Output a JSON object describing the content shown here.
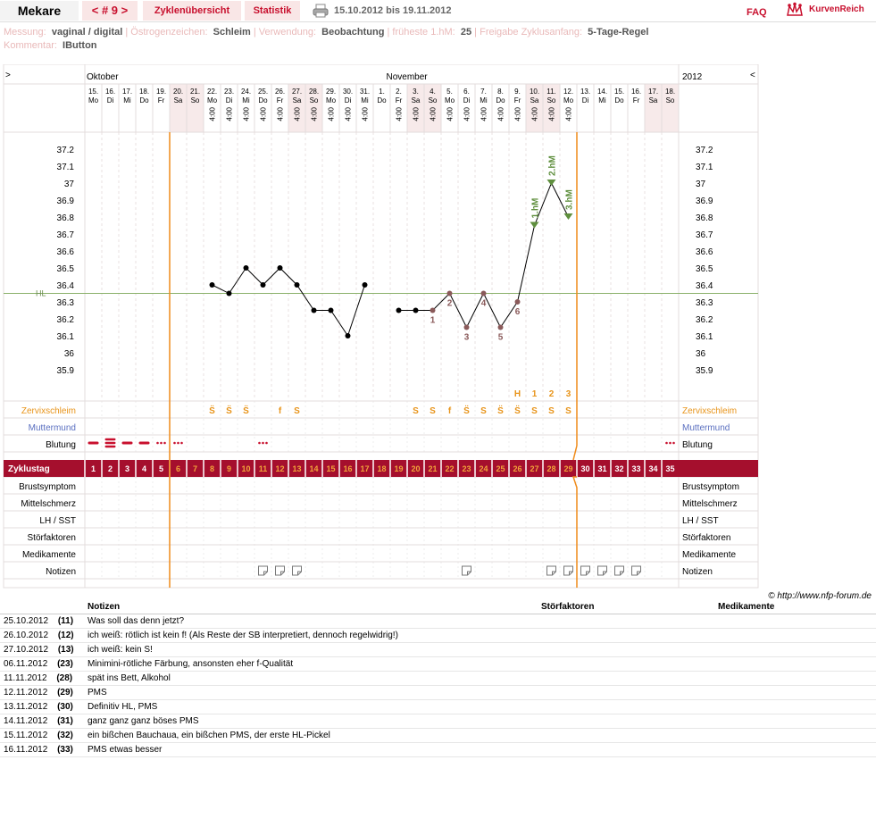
{
  "header": {
    "user": "Mekare",
    "cycle_nav": "< # 9 >",
    "tab_overview": "Zyklenübersicht",
    "tab_stats": "Statistik",
    "date_range": "15.10.2012 bis 19.11.2012",
    "faq": "FAQ",
    "logo": "KurvenReich"
  },
  "info": {
    "messung_label": "Messung:",
    "messung": "vaginal / digital",
    "oestrogen_label": "Östrogenzeichen:",
    "oestrogen": "Schleim",
    "verwendung_label": "Verwendung:",
    "verwendung": "Beobachtung",
    "fhm_label": "früheste 1.hM:",
    "fhm": "25",
    "freigabe_label": "Freigabe Zyklusanfang:",
    "freigabe": "5-Tage-Regel",
    "kommentar_label": "Kommentar:",
    "kommentar": "IButton"
  },
  "chart": {
    "month_left": "Oktober",
    "month_mid": "November",
    "year": "2012",
    "nav_prev": ">",
    "nav_next": "<",
    "hl_label": "HL",
    "hl_value": 36.35,
    "y_ticks": [
      "37.2",
      "37.1",
      "37",
      "36.9",
      "36.8",
      "36.7",
      "36.6",
      "36.5",
      "36.4",
      "36.3",
      "36.2",
      "36.1",
      "36",
      "35.9"
    ],
    "days": [
      {
        "d": "15.",
        "w": "Mo",
        "t": "",
        "c": "1"
      },
      {
        "d": "16.",
        "w": "Di",
        "t": "",
        "c": "2"
      },
      {
        "d": "17.",
        "w": "Mi",
        "t": "",
        "c": "3"
      },
      {
        "d": "18.",
        "w": "Do",
        "t": "",
        "c": "4"
      },
      {
        "d": "19.",
        "w": "Fr",
        "t": "",
        "c": "5"
      },
      {
        "d": "20.",
        "w": "Sa",
        "t": "",
        "c": "6"
      },
      {
        "d": "21.",
        "w": "So",
        "t": "",
        "c": "7"
      },
      {
        "d": "22.",
        "w": "Mo",
        "t": "4:00",
        "c": "8"
      },
      {
        "d": "23.",
        "w": "Di",
        "t": "4:00",
        "c": "9"
      },
      {
        "d": "24.",
        "w": "Mi",
        "t": "4:00",
        "c": "10"
      },
      {
        "d": "25.",
        "w": "Do",
        "t": "4:00",
        "c": "11"
      },
      {
        "d": "26.",
        "w": "Fr",
        "t": "4:00",
        "c": "12"
      },
      {
        "d": "27.",
        "w": "Sa",
        "t": "4:00",
        "c": "13"
      },
      {
        "d": "28.",
        "w": "So",
        "t": "4:00",
        "c": "14"
      },
      {
        "d": "29.",
        "w": "Mo",
        "t": "4:00",
        "c": "15"
      },
      {
        "d": "30.",
        "w": "Di",
        "t": "4:00",
        "c": "16"
      },
      {
        "d": "31.",
        "w": "Mi",
        "t": "4:00",
        "c": "17"
      },
      {
        "d": "1.",
        "w": "Do",
        "t": "",
        "c": "18"
      },
      {
        "d": "2.",
        "w": "Fr",
        "t": "4:00",
        "c": "19"
      },
      {
        "d": "3.",
        "w": "Sa",
        "t": "4:00",
        "c": "20"
      },
      {
        "d": "4.",
        "w": "So",
        "t": "4:00",
        "c": "21"
      },
      {
        "d": "5.",
        "w": "Mo",
        "t": "4:00",
        "c": "22"
      },
      {
        "d": "6.",
        "w": "Di",
        "t": "4:00",
        "c": "23"
      },
      {
        "d": "7.",
        "w": "Mi",
        "t": "4:00",
        "c": "24"
      },
      {
        "d": "8.",
        "w": "Do",
        "t": "4:00",
        "c": "25"
      },
      {
        "d": "9.",
        "w": "Fr",
        "t": "4:00",
        "c": "26"
      },
      {
        "d": "10.",
        "w": "Sa",
        "t": "4:00",
        "c": "27"
      },
      {
        "d": "11.",
        "w": "So",
        "t": "4:00",
        "c": "28"
      },
      {
        "d": "12.",
        "w": "Mo",
        "t": "4:00",
        "c": "29"
      },
      {
        "d": "13.",
        "w": "Di",
        "t": "",
        "c": "30"
      },
      {
        "d": "14.",
        "w": "Mi",
        "t": "",
        "c": "31"
      },
      {
        "d": "15.",
        "w": "Do",
        "t": "",
        "c": "32"
      },
      {
        "d": "16.",
        "w": "Fr",
        "t": "",
        "c": "33"
      },
      {
        "d": "17.",
        "w": "Sa",
        "t": "",
        "c": "34"
      },
      {
        "d": "18.",
        "w": "So",
        "t": "",
        "c": "35"
      }
    ],
    "rows_left": [
      "Zervixschleim",
      "Muttermund",
      "Blutung",
      "Zyklustag",
      "Brustsymptom",
      "Mittelschmerz",
      "LH / SST",
      "Störfaktoren",
      "Medikamente",
      "Notizen"
    ],
    "rows_right": [
      "Zervixschleim",
      "Muttermund",
      "Blutung",
      "Brustsymptom",
      "Mittelschmerz",
      "LH / SST",
      "Störfaktoren",
      "Medikamente",
      "Notizen"
    ],
    "copyright": "© http://www.nfp-forum.de"
  },
  "chart_data": {
    "type": "line",
    "xlabel": "",
    "ylabel": "",
    "ylim": [
      35.9,
      37.2
    ],
    "series": [
      {
        "points": [
          [
            8,
            36.4
          ],
          [
            9,
            36.35
          ],
          [
            10,
            36.5
          ],
          [
            11,
            36.4
          ],
          [
            12,
            36.5
          ],
          [
            13,
            36.4
          ],
          [
            14,
            36.25
          ],
          [
            15,
            36.25
          ],
          [
            16,
            36.1
          ],
          [
            17,
            36.4
          ]
        ]
      },
      {
        "points": [
          [
            19,
            36.25
          ],
          [
            20,
            36.25
          ],
          [
            21,
            36.25
          ],
          [
            22,
            36.35
          ],
          [
            23,
            36.15
          ],
          [
            24,
            36.35
          ],
          [
            25,
            36.15
          ],
          [
            26,
            36.3
          ],
          [
            27,
            36.75
          ],
          [
            28,
            37.0
          ],
          [
            29,
            36.8
          ]
        ]
      }
    ],
    "low_marks": [
      {
        "day": 21,
        "n": "1"
      },
      {
        "day": 22,
        "n": "2"
      },
      {
        "day": 23,
        "n": "3"
      },
      {
        "day": 24,
        "n": "4"
      },
      {
        "day": 25,
        "n": "5"
      },
      {
        "day": 26,
        "n": "6"
      }
    ],
    "high_marks": [
      {
        "day": 27,
        "n": "1.hM"
      },
      {
        "day": 28,
        "n": "2.hM"
      },
      {
        "day": 29,
        "n": "3.hM"
      }
    ],
    "mucus": [
      {
        "day": 8,
        "s": "S̈"
      },
      {
        "day": 9,
        "s": "S̈"
      },
      {
        "day": 10,
        "s": "S̈"
      },
      {
        "day": 12,
        "s": "f"
      },
      {
        "day": 13,
        "s": "S"
      },
      {
        "day": 20,
        "s": "S"
      },
      {
        "day": 21,
        "s": "S"
      },
      {
        "day": 22,
        "s": "f"
      },
      {
        "day": 23,
        "s": "S̈"
      },
      {
        "day": 24,
        "s": "S"
      },
      {
        "day": 25,
        "s": "S̈"
      },
      {
        "day": 26,
        "s": "S̈"
      },
      {
        "day": 27,
        "s": "S"
      },
      {
        "day": 28,
        "s": "S"
      },
      {
        "day": 29,
        "s": "S"
      }
    ],
    "mucus_eval": [
      {
        "day": 26,
        "s": "H"
      },
      {
        "day": 27,
        "s": "1"
      },
      {
        "day": 28,
        "s": "2"
      },
      {
        "day": 29,
        "s": "3"
      }
    ],
    "bleeding": [
      {
        "day": 1,
        "k": "dash"
      },
      {
        "day": 2,
        "k": "bars"
      },
      {
        "day": 3,
        "k": "dash"
      },
      {
        "day": 4,
        "k": "dash"
      },
      {
        "day": 5,
        "k": "dots"
      },
      {
        "day": 6,
        "k": "dots"
      },
      {
        "day": 11,
        "k": "dots"
      },
      {
        "day": 35,
        "k": "dots"
      }
    ],
    "notes_days": [
      11,
      12,
      13,
      23,
      28,
      29,
      30,
      31,
      32,
      33
    ]
  },
  "notes": {
    "col_notes": "Notizen",
    "col_stoer": "Störfaktoren",
    "col_med": "Medikamente",
    "rows": [
      {
        "date": "25.10.2012",
        "day": "(11)",
        "text": "Was soll das denn jetzt?"
      },
      {
        "date": "26.10.2012",
        "day": "(12)",
        "text": "ich weiß: rötlich ist kein f! (Als Reste der SB interpretiert, dennoch regelwidrig!)"
      },
      {
        "date": "27.10.2012",
        "day": "(13)",
        "text": "ich weiß: kein S!"
      },
      {
        "date": "06.11.2012",
        "day": "(23)",
        "text": "Minimini-rötliche Färbung, ansonsten eher f-Qualität"
      },
      {
        "date": "11.11.2012",
        "day": "(28)",
        "text": "spät ins Bett, Alkohol"
      },
      {
        "date": "12.11.2012",
        "day": "(29)",
        "text": "PMS"
      },
      {
        "date": "13.11.2012",
        "day": "(30)",
        "text": "Definitiv HL, PMS"
      },
      {
        "date": "14.11.2012",
        "day": "(31)",
        "text": "ganz ganz ganz böses PMS"
      },
      {
        "date": "15.11.2012",
        "day": "(32)",
        "text": "ein bißchen Bauchaua, ein bißchen PMS, der erste HL-Pickel"
      },
      {
        "date": "16.11.2012",
        "day": "(33)",
        "text": "PMS etwas besser"
      }
    ]
  }
}
